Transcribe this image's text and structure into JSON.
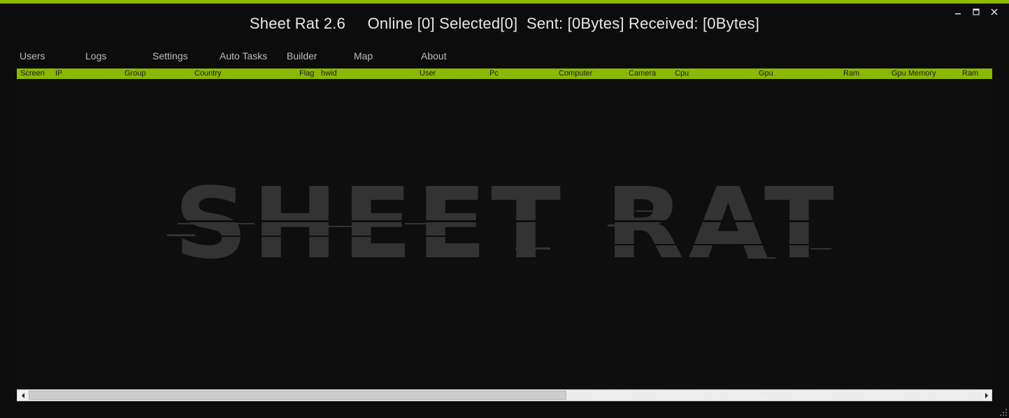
{
  "window": {
    "title": "Sheet Rat 2.6     Online [0] Selected[0]  Sent: [0Bytes] Received: [0Bytes]",
    "controls": {
      "minimize": "minimize-icon",
      "maximize": "maximize-icon",
      "close": "close-icon"
    }
  },
  "tabs": [
    {
      "label": "Users",
      "active": true
    },
    {
      "label": "Logs"
    },
    {
      "label": "Settings"
    },
    {
      "label": "Auto Tasks"
    },
    {
      "label": "Builder"
    },
    {
      "label": "Map"
    },
    {
      "label": "About"
    }
  ],
  "grid": {
    "columns": [
      "Screen",
      "IP",
      "Group",
      "Country",
      "Flag",
      "hwid",
      "User",
      "Pc",
      "Computer",
      "Camera",
      "Cpu",
      "Gpu",
      "Ram",
      "Gpu Memory",
      "Ram"
    ],
    "rows": []
  },
  "watermark": {
    "text": "SHEET RAT"
  },
  "colors": {
    "accent": "#8bb800",
    "background": "#0c0c0c",
    "watermark": "#333333"
  }
}
